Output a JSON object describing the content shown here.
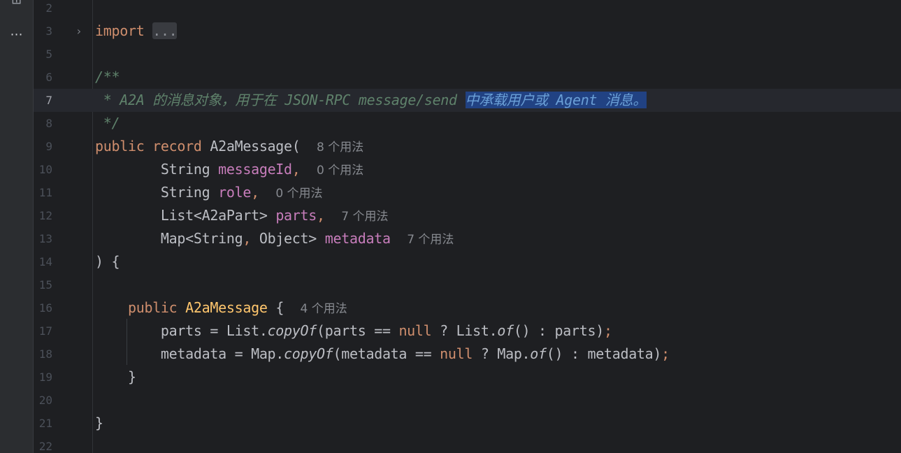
{
  "colors": {
    "background": "#1e1f22",
    "gutter": "#2b2d30",
    "keyword": "#cf8e6d",
    "field": "#c77dbb",
    "declaration": "#ffc66d",
    "doc_comment": "#5f826b",
    "selection": "#214283",
    "hint": "#86898f"
  },
  "toolstrip": {
    "partial_icon": "⊟",
    "more_icon": "⋯"
  },
  "editor": {
    "current_line": "7",
    "lines": [
      {
        "number": "2",
        "fold": "",
        "tokens": []
      },
      {
        "number": "3",
        "fold": "›",
        "tokens": [
          {
            "t": "kw",
            "v": "import"
          },
          {
            "t": "plain",
            "v": " "
          },
          {
            "t": "fold",
            "v": "..."
          }
        ]
      },
      {
        "number": "5",
        "fold": "",
        "tokens": []
      },
      {
        "number": "6",
        "fold": "",
        "tokens": [
          {
            "t": "doc",
            "v": "/**"
          }
        ]
      },
      {
        "number": "7",
        "fold": "",
        "tokens": [
          {
            "t": "doc",
            "v": " * A2A 的消息对象，用于在 JSON-RPC message/send "
          },
          {
            "t": "docsel",
            "v": "中承载用户或 Agent 消息。"
          }
        ]
      },
      {
        "number": "8",
        "fold": "",
        "tokens": [
          {
            "t": "doc",
            "v": " */"
          }
        ]
      },
      {
        "number": "9",
        "fold": "",
        "tokens": [
          {
            "t": "kw",
            "v": "public record "
          },
          {
            "t": "plain",
            "v": "A2aMessage(  "
          },
          {
            "t": "hint",
            "v": "8 个用法"
          }
        ]
      },
      {
        "number": "10",
        "fold": "",
        "tokens": [
          {
            "t": "plain",
            "v": "        String "
          },
          {
            "t": "field",
            "v": "messageId"
          },
          {
            "t": "kw",
            "v": ","
          },
          {
            "t": "plain",
            "v": "  "
          },
          {
            "t": "hint",
            "v": "0 个用法"
          }
        ]
      },
      {
        "number": "11",
        "fold": "",
        "tokens": [
          {
            "t": "plain",
            "v": "        String "
          },
          {
            "t": "field",
            "v": "role"
          },
          {
            "t": "kw",
            "v": ","
          },
          {
            "t": "plain",
            "v": "  "
          },
          {
            "t": "hint",
            "v": "0 个用法"
          }
        ]
      },
      {
        "number": "12",
        "fold": "",
        "tokens": [
          {
            "t": "plain",
            "v": "        List<A2aPart> "
          },
          {
            "t": "field",
            "v": "parts"
          },
          {
            "t": "kw",
            "v": ","
          },
          {
            "t": "plain",
            "v": "  "
          },
          {
            "t": "hint",
            "v": "7 个用法"
          }
        ]
      },
      {
        "number": "13",
        "fold": "",
        "tokens": [
          {
            "t": "plain",
            "v": "        Map<String"
          },
          {
            "t": "kw",
            "v": ","
          },
          {
            "t": "plain",
            "v": " Object> "
          },
          {
            "t": "field",
            "v": "metadata"
          },
          {
            "t": "plain",
            "v": "  "
          },
          {
            "t": "hint",
            "v": "7 个用法"
          }
        ]
      },
      {
        "number": "14",
        "fold": "",
        "tokens": [
          {
            "t": "plain",
            "v": ") {"
          }
        ]
      },
      {
        "number": "15",
        "fold": "",
        "tokens": []
      },
      {
        "number": "16",
        "fold": "",
        "tokens": [
          {
            "t": "plain",
            "v": "    "
          },
          {
            "t": "kw",
            "v": "public "
          },
          {
            "t": "decl",
            "v": "A2aMessage"
          },
          {
            "t": "plain",
            "v": " {  "
          },
          {
            "t": "hint",
            "v": "4 个用法"
          }
        ]
      },
      {
        "number": "17",
        "fold": "",
        "tokens": [
          {
            "t": "plain",
            "v": "        parts = List."
          },
          {
            "t": "static",
            "v": "copyOf"
          },
          {
            "t": "plain",
            "v": "(parts == "
          },
          {
            "t": "kw",
            "v": "null"
          },
          {
            "t": "plain",
            "v": " ? List."
          },
          {
            "t": "static",
            "v": "of"
          },
          {
            "t": "plain",
            "v": "() : parts)"
          },
          {
            "t": "kw",
            "v": ";"
          }
        ]
      },
      {
        "number": "18",
        "fold": "",
        "tokens": [
          {
            "t": "plain",
            "v": "        metadata = Map."
          },
          {
            "t": "static",
            "v": "copyOf"
          },
          {
            "t": "plain",
            "v": "(metadata == "
          },
          {
            "t": "kw",
            "v": "null"
          },
          {
            "t": "plain",
            "v": " ? Map."
          },
          {
            "t": "static",
            "v": "of"
          },
          {
            "t": "plain",
            "v": "() : metadata)"
          },
          {
            "t": "kw",
            "v": ";"
          }
        ]
      },
      {
        "number": "19",
        "fold": "",
        "tokens": [
          {
            "t": "plain",
            "v": "    }"
          }
        ]
      },
      {
        "number": "20",
        "fold": "",
        "tokens": []
      },
      {
        "number": "21",
        "fold": "",
        "tokens": [
          {
            "t": "plain",
            "v": "}"
          }
        ]
      },
      {
        "number": "22",
        "fold": "",
        "tokens": []
      }
    ]
  }
}
